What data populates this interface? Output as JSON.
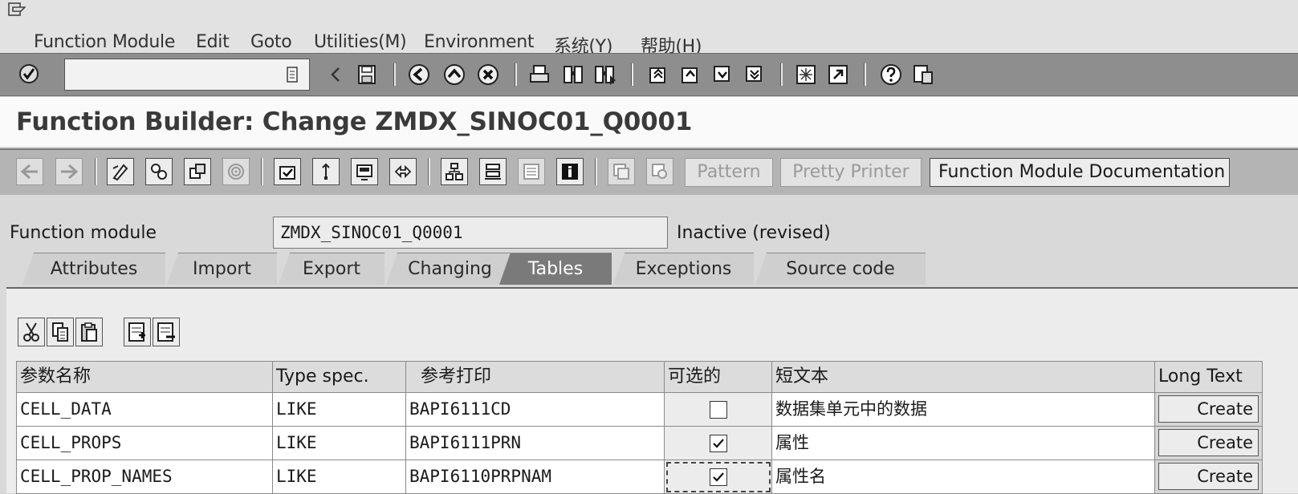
{
  "menu": {
    "items": [
      {
        "label": "Function Module"
      },
      {
        "label": "Edit"
      },
      {
        "label": "Goto"
      },
      {
        "label": "Utilities(M)"
      },
      {
        "label": "Environment"
      },
      {
        "label": "系统(Y)"
      },
      {
        "label": "帮助(H)"
      }
    ]
  },
  "command_field": {
    "value": ""
  },
  "title": "Function Builder: Change ZMDX_SINOC01_Q0001",
  "app_toolbar": {
    "pattern_label": "Pattern",
    "pretty_printer_label": "Pretty Printer",
    "documentation_label": "Function Module Documentation"
  },
  "header": {
    "function_module_label": "Function module",
    "function_module_value": "ZMDX_SINOC01_Q0001",
    "status": "Inactive (revised)"
  },
  "tabs": [
    {
      "label": "Attributes",
      "active": false
    },
    {
      "label": "Import",
      "active": false
    },
    {
      "label": "Export",
      "active": false
    },
    {
      "label": "Changing",
      "active": false
    },
    {
      "label": "Tables",
      "active": true
    },
    {
      "label": "Exceptions",
      "active": false
    },
    {
      "label": "Source code",
      "active": false
    }
  ],
  "table": {
    "columns": [
      "参数名称",
      "Type spec.",
      "参考打印",
      "可选的",
      "短文本",
      "Long Text"
    ],
    "rows": [
      {
        "name": "CELL_DATA",
        "type_spec": "LIKE",
        "reference": "BAPI6111CD",
        "optional": false,
        "short_text": "数据集单元中的数据",
        "long_text": "Create"
      },
      {
        "name": "CELL_PROPS",
        "type_spec": "LIKE",
        "reference": "BAPI6111PRN",
        "optional": true,
        "short_text": "属性",
        "long_text": "Create"
      },
      {
        "name": "CELL_PROP_NAMES",
        "type_spec": "LIKE",
        "reference": "BAPI6110PRPNAM",
        "optional": true,
        "short_text": "属性名",
        "long_text": "Create"
      }
    ]
  }
}
